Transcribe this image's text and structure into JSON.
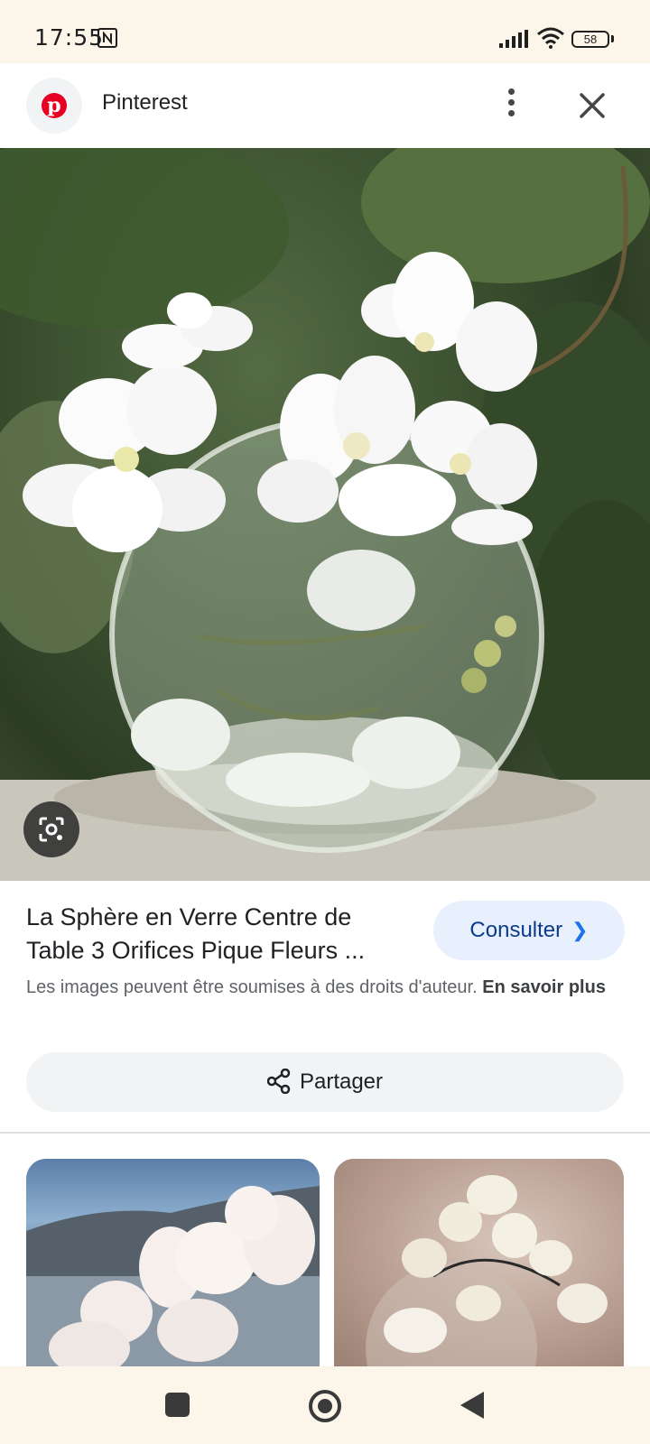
{
  "status_bar": {
    "time": "17:55",
    "battery": "58"
  },
  "header": {
    "site_name": "Pinterest",
    "logo_letter": "p"
  },
  "result": {
    "title": "La Sphère en Verre Centre de Table 3 Orifices Pique Fleurs ...",
    "consult_label": "Consulter",
    "copyright_text": "Les images peuvent être soumises à des droits d'auteur.",
    "learn_more": "En savoir plus",
    "share_label": "Partager"
  },
  "icons": [
    "nfc-icon",
    "signal-icon",
    "wifi-icon",
    "battery-icon",
    "pinterest-logo-icon",
    "more-vert-icon",
    "close-icon",
    "lens-search-icon",
    "share-icon",
    "chevron-right-icon",
    "recents-icon",
    "home-icon",
    "back-icon"
  ],
  "colors": {
    "pinterest_red": "#e60023",
    "consult_bg": "#e8f0fe",
    "consult_text": "#0b3b8c",
    "share_bg": "#f1f3f4",
    "system_bar_bg": "#fbf6e9"
  }
}
